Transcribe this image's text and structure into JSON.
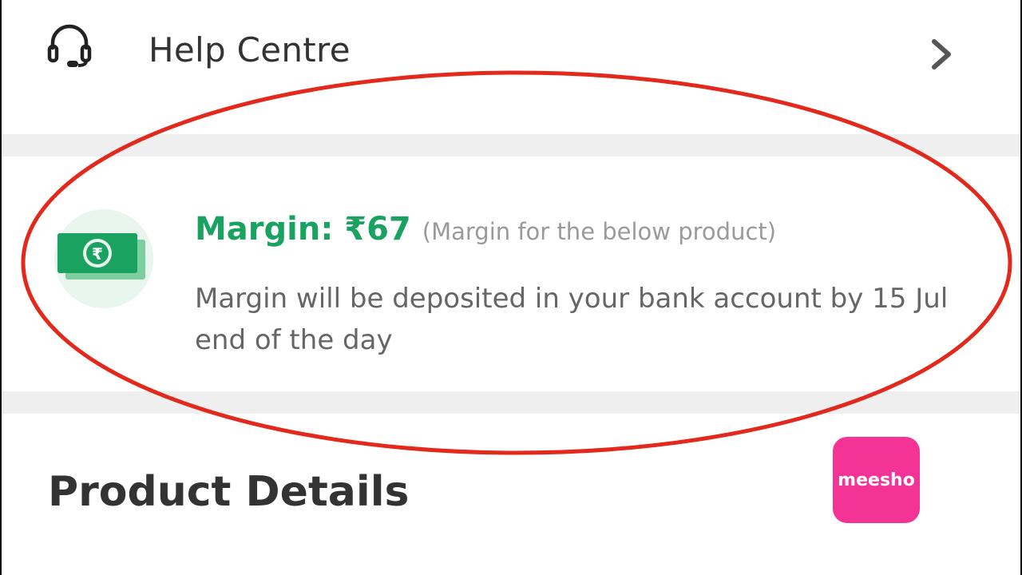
{
  "help": {
    "label": "Help Centre",
    "icon": "headset-icon",
    "chevron_icon": "chevron-right-icon"
  },
  "margin": {
    "title": "Margin: ₹67",
    "subtitle": "(Margin for the below product)",
    "description": "Margin will be deposited in your bank account by 15 Jul end of the day",
    "icon": "rupee-cash-icon",
    "accent_color": "#1aa260"
  },
  "product": {
    "title": "Product Details"
  },
  "logo": {
    "text": "meesho",
    "color": "#f43397"
  },
  "annotation": {
    "color": "#e3281c"
  }
}
